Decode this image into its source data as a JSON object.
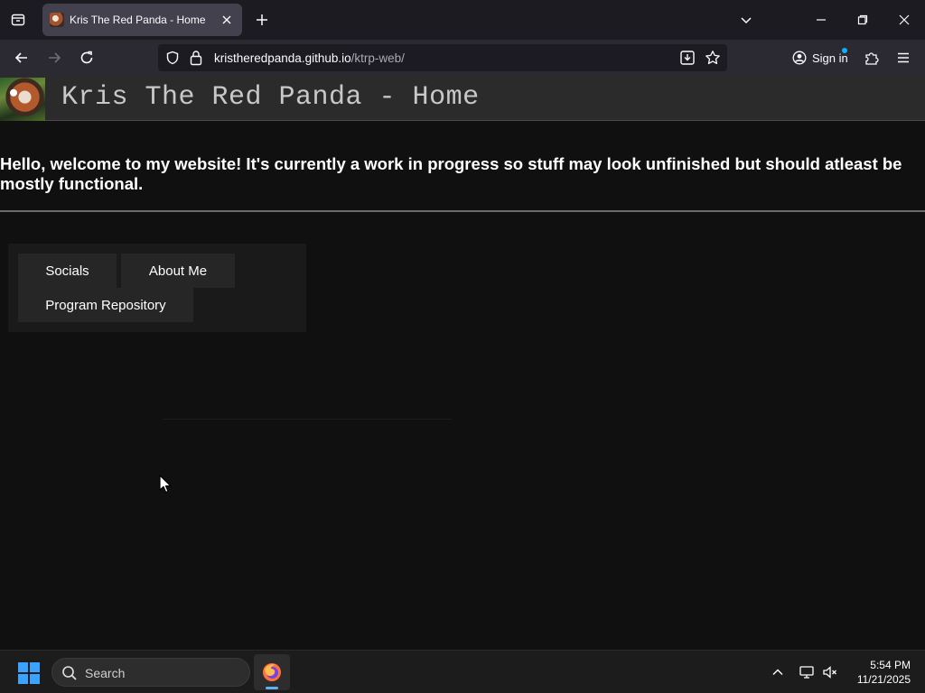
{
  "browser": {
    "tab": {
      "title": "Kris The Red Panda - Home"
    },
    "url": {
      "host": "kristheredpanda.github.io",
      "path": "/ktrp-web/"
    },
    "signin_label": "Sign in"
  },
  "page": {
    "title": "Kris The Red Panda - Home",
    "welcome": "Hello, welcome to my website! It's currently a work in progress so stuff may look unfinished but should atleast be mostly functional.",
    "nav": [
      {
        "label": "Socials"
      },
      {
        "label": "About Me"
      },
      {
        "label": "Program Repository"
      }
    ]
  },
  "taskbar": {
    "search_label": "Search",
    "time": "5:54 PM",
    "date": "11/21/2025"
  },
  "colors": {
    "accent": "#0cb0ff",
    "page_bg": "#111011",
    "header_bg": "#2b2b2b"
  }
}
